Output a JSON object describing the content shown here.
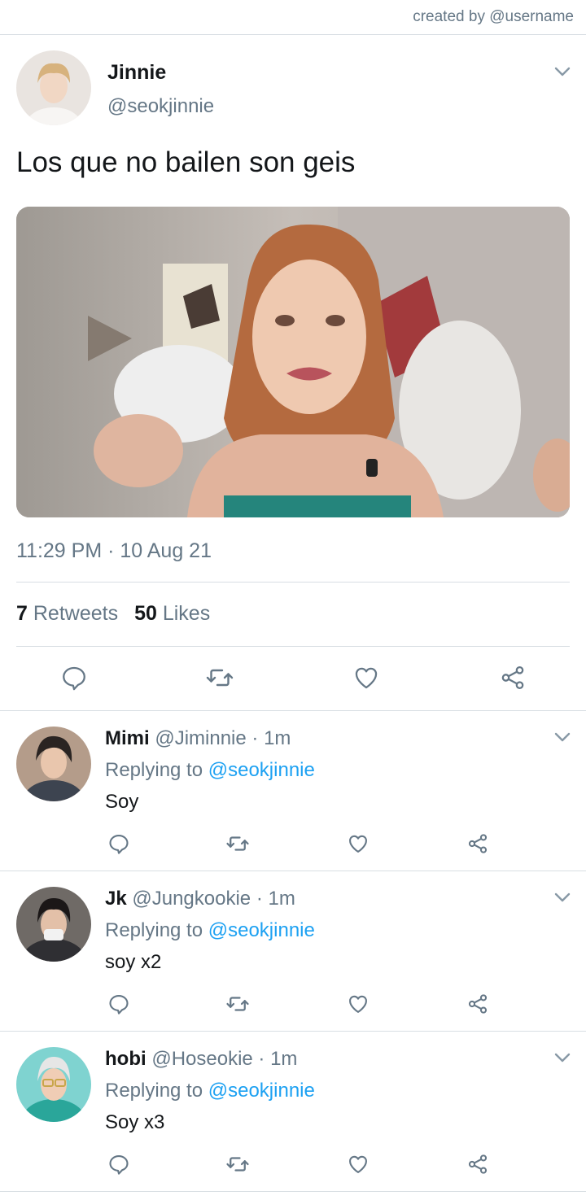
{
  "credit": "created by @username",
  "tweet": {
    "display_name": "Jinnie",
    "handle": "@seokjinnie",
    "text": "Los que no bailen son geis",
    "timestamp": "11:29 PM · 10 Aug 21",
    "retweets_count": "7",
    "retweets_label": "Retweets",
    "likes_count": "50",
    "likes_label": "Likes"
  },
  "actions": {
    "reply_icon": "reply-bubble-icon",
    "retweet_icon": "retweet-icon",
    "like_icon": "heart-icon",
    "share_icon": "share-icon"
  },
  "replies": [
    {
      "display_name": "Mimi",
      "handle": "@Jiminnie",
      "time": "· 1m",
      "replying_prefix": "Replying to",
      "replying_to": "@seokjinnie",
      "text": "Soy"
    },
    {
      "display_name": "Jk",
      "handle": "@Jungkookie",
      "time": "· 1m",
      "replying_prefix": "Replying to",
      "replying_to": "@seokjinnie",
      "text": "soy x2"
    },
    {
      "display_name": "hobi",
      "handle": "@Hoseokie",
      "time": "· 1m",
      "replying_prefix": "Replying to",
      "replying_to": "@seokjinnie",
      "text": "Soy x3"
    }
  ],
  "colors": {
    "link": "#1da1f2",
    "secondary": "#657786",
    "divider": "#d8dee3"
  }
}
